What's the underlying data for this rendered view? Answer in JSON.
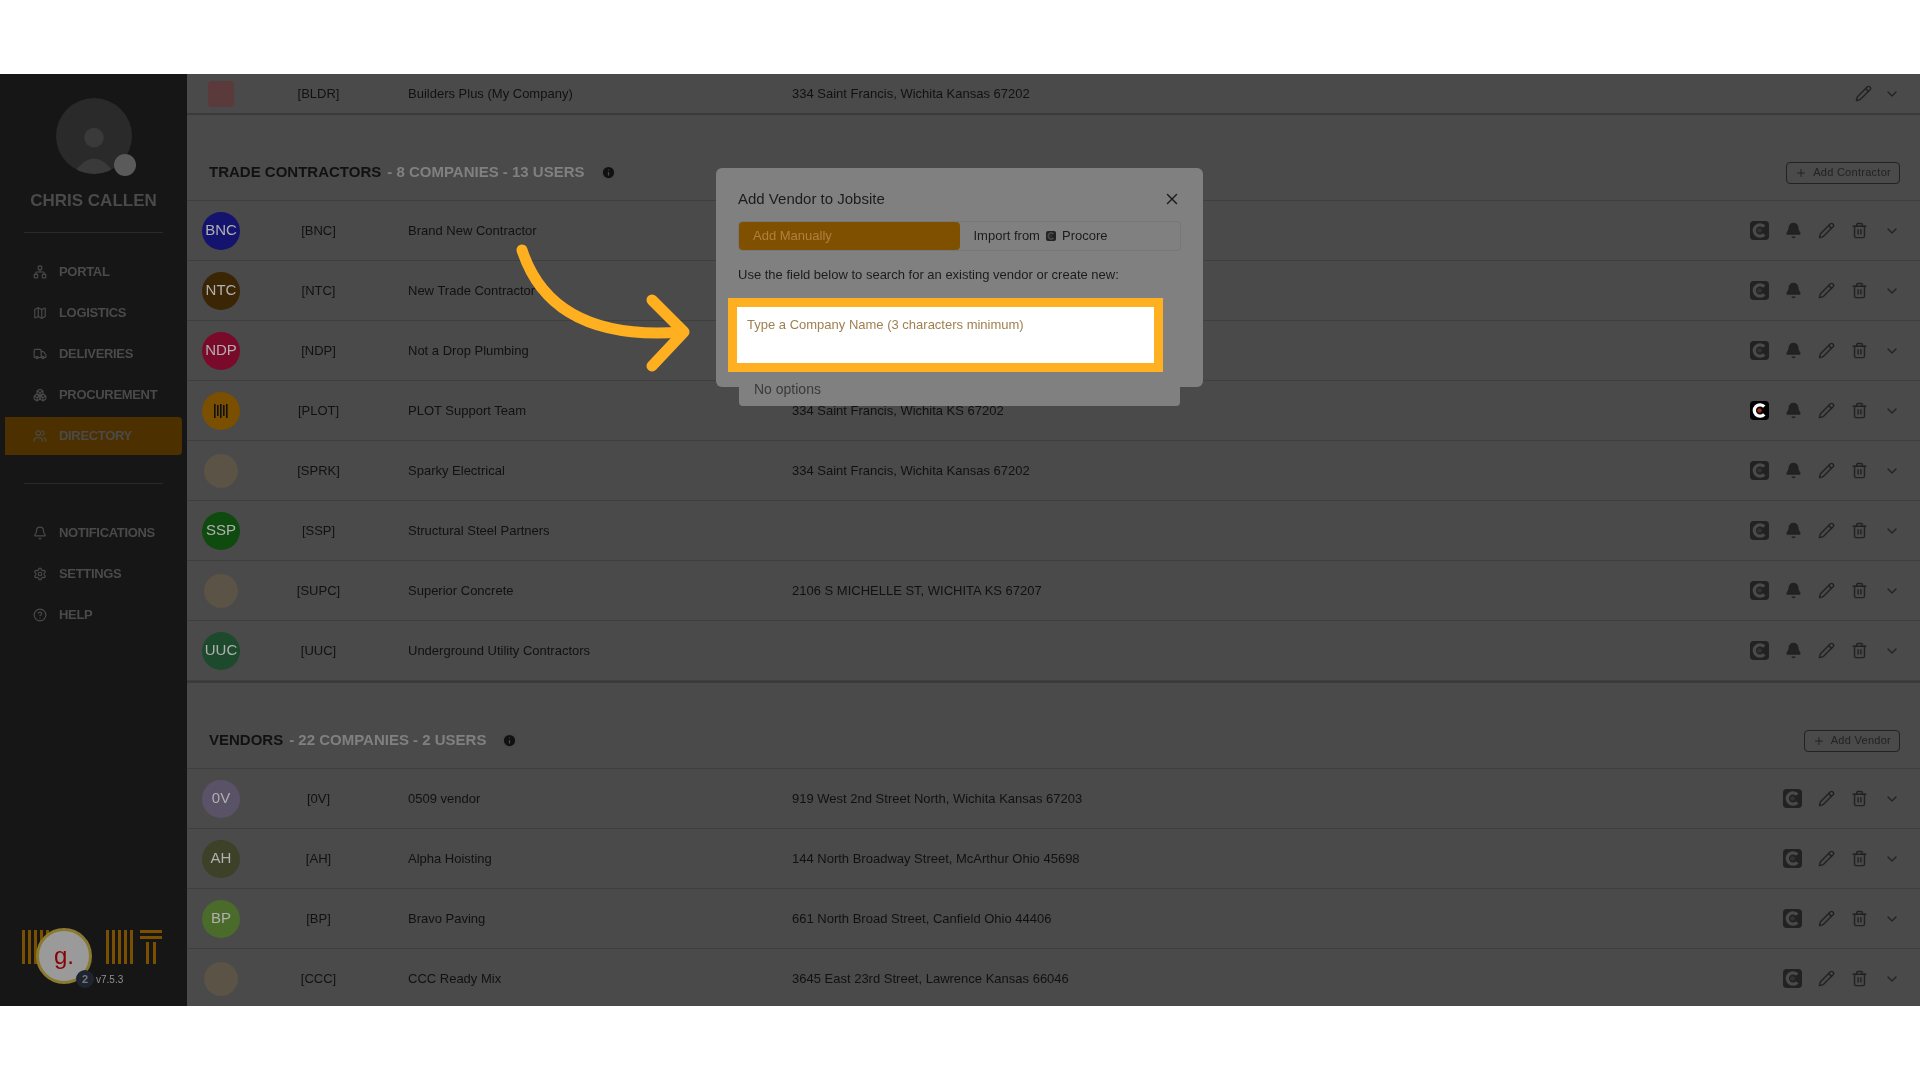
{
  "sidebar": {
    "user_name": "CHRIS CALLEN",
    "nav": [
      {
        "label": "PORTAL",
        "selected": false
      },
      {
        "label": "LOGISTICS",
        "selected": false
      },
      {
        "label": "DELIVERIES",
        "selected": false
      },
      {
        "label": "PROCUREMENT",
        "selected": false
      },
      {
        "label": "DIRECTORY",
        "selected": true
      }
    ],
    "nav_secondary": [
      {
        "label": "NOTIFICATIONS",
        "selected": false
      },
      {
        "label": "SETTINGS",
        "selected": false
      },
      {
        "label": "HELP",
        "selected": false
      }
    ],
    "assistant": {
      "letter": "g.",
      "badge": "2"
    },
    "version": "v7.5.3"
  },
  "my_company": {
    "code": "[BLDR]",
    "name": "Builders Plus (My Company)",
    "address": "334 Saint Francis, Wichita Kansas 67202"
  },
  "sections": [
    {
      "kind": "contractors",
      "title": "TRADE CONTRACTORS",
      "stats": "- 8 COMPANIES - 13 USERS",
      "add_button": "Add Contractor",
      "rows": [
        {
          "avatar": {
            "kind": "initials",
            "text": "BNC",
            "color": "#14146e"
          },
          "code": "[BNC]",
          "name": "Brand New Contractor",
          "address": "",
          "procore_linked": false
        },
        {
          "avatar": {
            "kind": "initials",
            "text": "NTC",
            "color": "#3a2505"
          },
          "code": "[NTC]",
          "name": "New Trade Contractor",
          "address": "",
          "procore_linked": false
        },
        {
          "avatar": {
            "kind": "initials",
            "text": "NDP",
            "color": "#7a0a2a"
          },
          "code": "[NDP]",
          "name": "Not a Drop Plumbing",
          "address": "",
          "procore_linked": false
        },
        {
          "avatar": {
            "kind": "bars",
            "color": "#7a4f00"
          },
          "code": "[PLOT]",
          "name": "PLOT Support Team",
          "address": "334 Saint Francis, Wichita KS 67202",
          "procore_linked": true
        },
        {
          "avatar": {
            "kind": "logo"
          },
          "code": "[SPRK]",
          "name": "Sparky Electrical",
          "address": "334 Saint Francis, Wichita Kansas 67202",
          "procore_linked": false
        },
        {
          "avatar": {
            "kind": "initials",
            "text": "SSP",
            "color": "#0f4a0f"
          },
          "code": "[SSP]",
          "name": "Structural Steel Partners",
          "address": "",
          "procore_linked": false
        },
        {
          "avatar": {
            "kind": "logo"
          },
          "code": "[SUPC]",
          "name": "Superior Concrete",
          "address": "2106 S MICHELLE ST, WICHITA KS 67207",
          "procore_linked": false
        },
        {
          "avatar": {
            "kind": "initials",
            "text": "UUC",
            "color": "#1d4a2d"
          },
          "code": "[UUC]",
          "name": "Underground Utility Contractors",
          "address": "",
          "procore_linked": false
        }
      ]
    },
    {
      "kind": "vendors",
      "title": "VENDORS",
      "stats": "- 22 COMPANIES - 2 USERS",
      "add_button": "Add Vendor",
      "rows": [
        {
          "avatar": {
            "kind": "initials",
            "text": "0V",
            "color": "#5a5368"
          },
          "code": "[0V]",
          "name": "0509 vendor",
          "address": "919 West 2nd Street North, Wichita Kansas 67203",
          "procore_linked": false
        },
        {
          "avatar": {
            "kind": "initials",
            "text": "AH",
            "color": "#3c4128"
          },
          "code": "[AH]",
          "name": "Alpha Hoisting",
          "address": "144 North Broadway Street, McArthur Ohio 45698",
          "procore_linked": false
        },
        {
          "avatar": {
            "kind": "initials",
            "text": "BP",
            "color": "#4b6b2a"
          },
          "code": "[BP]",
          "name": "Bravo Paving",
          "address": "661 North Broad Street, Canfield Ohio 44406",
          "procore_linked": false
        },
        {
          "avatar": {
            "kind": "logo"
          },
          "code": "[CCC]",
          "name": "CCC Ready Mix",
          "address": "3645 East 23rd Street, Lawrence Kansas 66046",
          "procore_linked": false
        }
      ]
    }
  ],
  "modal": {
    "title": "Add Vendor to Jobsite",
    "tabs": [
      {
        "label": "Add Manually",
        "selected": true
      },
      {
        "label": "Import from",
        "suffix": "Procore",
        "selected": false
      }
    ],
    "description": "Use the field below to search for an existing vendor or create new:",
    "search": {
      "placeholder": "Type a Company Name (3 characters minimum)"
    },
    "dropdown": "No options"
  }
}
